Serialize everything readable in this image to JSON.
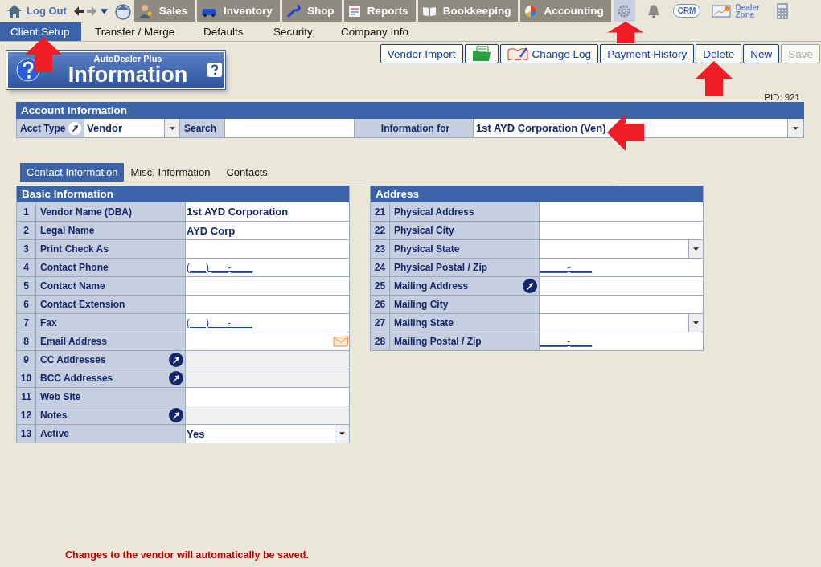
{
  "top_bar": {
    "logout": "Log Out",
    "modules": [
      {
        "label": "Sales",
        "selected": false
      },
      {
        "label": "Inventory",
        "selected": false
      },
      {
        "label": "Shop",
        "selected": false
      },
      {
        "label": "Reports",
        "selected": false
      },
      {
        "label": "Bookkeeping",
        "selected": false
      },
      {
        "label": "Accounting",
        "selected": false
      }
    ],
    "settings_selected": true,
    "crm": "CRM",
    "dealer_zone": "Dealer Zone"
  },
  "sub_tabs": [
    {
      "label": "Client Setup",
      "selected": true
    },
    {
      "label": "Transfer / Merge",
      "selected": false
    },
    {
      "label": "Defaults",
      "selected": false
    },
    {
      "label": "Security",
      "selected": false
    },
    {
      "label": "Company Info",
      "selected": false
    }
  ],
  "logo": {
    "brand": "AutoDealer Plus",
    "title": "Information"
  },
  "buttons": [
    {
      "kind": "text",
      "label": "Vendor Import",
      "access_key": false,
      "disabled": false
    },
    {
      "kind": "icon",
      "disabled": false
    },
    {
      "kind": "icon_text",
      "label": "Change Log",
      "access_key": false,
      "disabled": false
    },
    {
      "kind": "text",
      "label": "Payment History",
      "access_key": false,
      "disabled": false
    },
    {
      "kind": "text",
      "label": "Delete",
      "access_key": true,
      "disabled": false
    },
    {
      "kind": "text",
      "label": "New",
      "access_key": true,
      "disabled": false
    },
    {
      "kind": "text",
      "label": "Save",
      "access_key": true,
      "disabled": true
    }
  ],
  "pid": "PID: 921",
  "account": {
    "title": "Account Information",
    "acct_type_label": "Acct Type",
    "acct_type": "Vendor",
    "search_label": "Search",
    "info_for_label": "Information for",
    "info_for": "1st AYD Corporation (Ven)"
  },
  "tabs": [
    {
      "label": "Contact Information",
      "selected": true
    },
    {
      "label": "Misc. Information",
      "selected": false
    },
    {
      "label": "Contacts",
      "selected": false
    }
  ],
  "basic": {
    "title": "Basic Information",
    "rows": [
      {
        "num": "1",
        "label": "Vendor Name (DBA)",
        "kind": "text",
        "value": "1st AYD Corporation",
        "popup": false
      },
      {
        "num": "2",
        "label": "Legal Name",
        "kind": "text",
        "value": "AYD Corp",
        "popup": false
      },
      {
        "num": "3",
        "label": "Print Check As",
        "kind": "text",
        "popup": false
      },
      {
        "num": "4",
        "label": "Contact Phone",
        "kind": "mask",
        "value": "(___) ___-____",
        "popup": false
      },
      {
        "num": "5",
        "label": "Contact Name",
        "kind": "text",
        "popup": false
      },
      {
        "num": "6",
        "label": "Contact Extension",
        "kind": "text",
        "popup": false
      },
      {
        "num": "7",
        "label": "Fax",
        "kind": "mask",
        "value": "(___) ___-____",
        "popup": false
      },
      {
        "num": "8",
        "label": "Email Address",
        "kind": "email",
        "popup": false
      },
      {
        "num": "9",
        "label": "CC Addresses",
        "kind": "readonly",
        "popup": true
      },
      {
        "num": "10",
        "label": "BCC Addresses",
        "kind": "readonly",
        "popup": true
      },
      {
        "num": "11",
        "label": "Web Site",
        "kind": "text",
        "popup": false
      },
      {
        "num": "12",
        "label": "Notes",
        "kind": "readonly",
        "popup": true
      },
      {
        "num": "13",
        "label": "Active",
        "kind": "select",
        "value": "Yes",
        "popup": false
      }
    ]
  },
  "address": {
    "title": "Address",
    "rows": [
      {
        "num": "21",
        "label": "Physical Address",
        "kind": "text",
        "popup": false
      },
      {
        "num": "22",
        "label": "Physical City",
        "kind": "text",
        "popup": false
      },
      {
        "num": "23",
        "label": "Physical State",
        "kind": "select",
        "popup": false
      },
      {
        "num": "24",
        "label": "Physical Postal / Zip",
        "kind": "mask",
        "value": "_____-____",
        "popup": false
      },
      {
        "num": "25",
        "label": "Mailing Address",
        "kind": "text",
        "popup": true
      },
      {
        "num": "26",
        "label": "Mailing City",
        "kind": "text",
        "popup": false
      },
      {
        "num": "27",
        "label": "Mailing State",
        "kind": "select",
        "popup": false
      },
      {
        "num": "28",
        "label": "Mailing Postal / Zip",
        "kind": "mask",
        "value": "_____-____",
        "popup": false
      }
    ]
  },
  "footer_note": "Changes to the vendor will automatically be saved.",
  "annotations": [
    {
      "kind": "up_arrow"
    },
    {
      "kind": "up_arrow"
    },
    {
      "kind": "up_arrow"
    },
    {
      "kind": "left_arrow"
    }
  ]
}
